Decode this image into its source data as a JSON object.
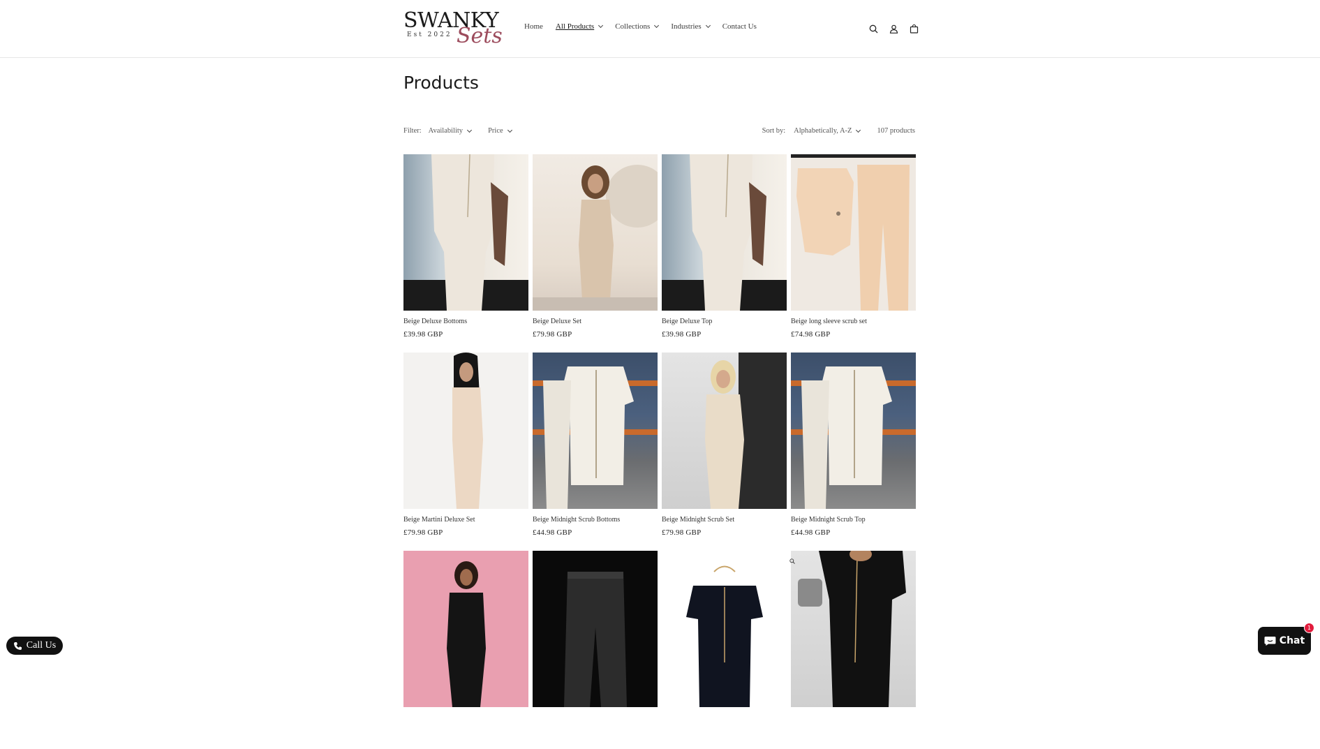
{
  "brand": {
    "name_top": "SWANKY",
    "name_script": "Sets",
    "est": "Est 2022"
  },
  "nav": {
    "items": [
      {
        "label": "Home",
        "dropdown": false,
        "active": false
      },
      {
        "label": "All Products",
        "dropdown": true,
        "active": true
      },
      {
        "label": "Collections",
        "dropdown": true,
        "active": false
      },
      {
        "label": "Industries",
        "dropdown": true,
        "active": false
      },
      {
        "label": "Contact Us",
        "dropdown": false,
        "active": false
      }
    ]
  },
  "header_icons": [
    "search-icon",
    "account-icon",
    "cart-icon"
  ],
  "page": {
    "title": "Products"
  },
  "filters": {
    "label": "Filter:",
    "availability": "Availability",
    "price": "Price",
    "sort_label": "Sort by:",
    "sort_value": "Alphabetically, A-Z",
    "count": "107 products"
  },
  "products": [
    {
      "name": "Beige Deluxe Bottoms",
      "price": "£39.98 GBP"
    },
    {
      "name": "Beige Deluxe Set",
      "price": "£79.98 GBP"
    },
    {
      "name": "Beige Deluxe Top",
      "price": "£39.98 GBP"
    },
    {
      "name": "Beige long sleeve scrub set",
      "price": "£74.98 GBP"
    },
    {
      "name": "Beige Martini Deluxe Set",
      "price": "£79.98 GBP"
    },
    {
      "name": "Beige Midnight Scrub Bottoms",
      "price": "£44.98 GBP"
    },
    {
      "name": "Beige Midnight Scrub Set",
      "price": "£79.98 GBP"
    },
    {
      "name": "Beige Midnight Scrub Top",
      "price": "£44.98 GBP"
    },
    {
      "name": "",
      "price": ""
    },
    {
      "name": "",
      "price": ""
    },
    {
      "name": "",
      "price": ""
    },
    {
      "name": "",
      "price": ""
    }
  ],
  "floating": {
    "call_us": "Call Us",
    "chat": "Chat",
    "chat_badge": "1"
  },
  "colors": {
    "accent_script": "#9c4b5c",
    "chat_badge": "#e21b3c",
    "button_dark": "#111111"
  }
}
